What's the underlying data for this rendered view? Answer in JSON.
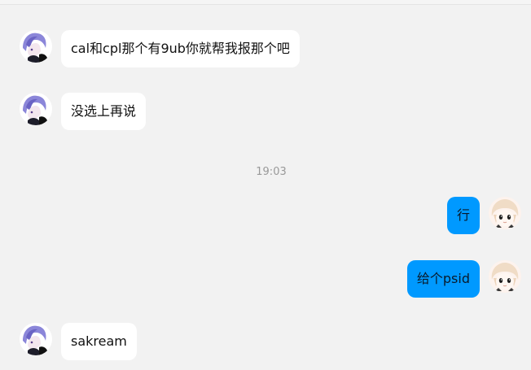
{
  "timestamp": "19:03",
  "messages": [
    {
      "side": "left",
      "text": "cal和cpl那个有9ub你就帮我报那个吧",
      "avatar": "anime-purple-hair-avatar"
    },
    {
      "side": "left",
      "text": "没选上再说",
      "avatar": "anime-purple-hair-avatar"
    },
    {
      "side": "right",
      "text": "行",
      "avatar": "anime-blonde-avatar"
    },
    {
      "side": "right",
      "text": "给个psid",
      "avatar": "anime-blonde-avatar"
    },
    {
      "side": "left",
      "text": "sakream",
      "avatar": "anime-purple-hair-avatar"
    }
  ],
  "colors": {
    "background": "#f2f2f2",
    "incoming_bubble": "#ffffff",
    "outgoing_bubble": "#0099ff",
    "timestamp_text": "#999999"
  }
}
